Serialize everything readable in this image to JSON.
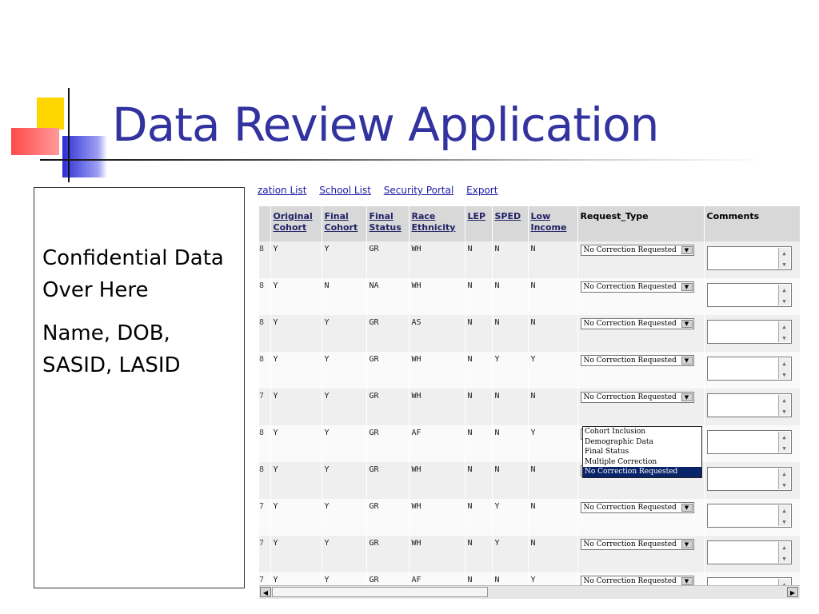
{
  "slide": {
    "title": "Data Review Application"
  },
  "left_box": {
    "line1": "Confidential Data Over Here",
    "line2": "Name, DOB, SASID, LASID"
  },
  "nav": [
    {
      "label": "zation List"
    },
    {
      "label": "School List"
    },
    {
      "label": "Security Portal"
    },
    {
      "label": "Export"
    }
  ],
  "columns": {
    "original_cohort": "Original Cohort",
    "final_cohort": "Final Cohort",
    "final_status": "Final Status",
    "race_ethnicity": "Race Ethnicity",
    "lep": "LEP",
    "sped": "SPED",
    "low_income": "Low Income",
    "request_type": "Request_Type",
    "comments": "Comments"
  },
  "rows": [
    {
      "idx": "8",
      "oc": "Y",
      "fc": "Y",
      "fs": "GR",
      "re": "WH",
      "lep": "N",
      "sped": "N",
      "li": "N",
      "req": "No Correction Requested"
    },
    {
      "idx": "8",
      "oc": "Y",
      "fc": "N",
      "fs": "NA",
      "re": "WH",
      "lep": "N",
      "sped": "N",
      "li": "N",
      "req": "No Correction Requested"
    },
    {
      "idx": "8",
      "oc": "Y",
      "fc": "Y",
      "fs": "GR",
      "re": "AS",
      "lep": "N",
      "sped": "N",
      "li": "N",
      "req": "No Correction Requested"
    },
    {
      "idx": "8",
      "oc": "Y",
      "fc": "Y",
      "fs": "GR",
      "re": "WH",
      "lep": "N",
      "sped": "Y",
      "li": "Y",
      "req": "No Correction Requested"
    },
    {
      "idx": "7",
      "oc": "Y",
      "fc": "Y",
      "fs": "GR",
      "re": "WH",
      "lep": "N",
      "sped": "N",
      "li": "N",
      "req": "No Correction Requested"
    },
    {
      "idx": "8",
      "oc": "Y",
      "fc": "Y",
      "fs": "GR",
      "re": "AF",
      "lep": "N",
      "sped": "N",
      "li": "Y",
      "req": "No Correction Requested"
    },
    {
      "idx": "8",
      "oc": "Y",
      "fc": "Y",
      "fs": "GR",
      "re": "WH",
      "lep": "N",
      "sped": "N",
      "li": "N",
      "req": "No Correction Requested"
    },
    {
      "idx": "7",
      "oc": "Y",
      "fc": "Y",
      "fs": "GR",
      "re": "WH",
      "lep": "N",
      "sped": "Y",
      "li": "N",
      "req": "No Correction Requested"
    },
    {
      "idx": "7",
      "oc": "Y",
      "fc": "Y",
      "fs": "GR",
      "re": "WH",
      "lep": "N",
      "sped": "Y",
      "li": "N",
      "req": "No Correction Requested"
    },
    {
      "idx": "7",
      "oc": "Y",
      "fc": "Y",
      "fs": "GR",
      "re": "AF",
      "lep": "N",
      "sped": "N",
      "li": "Y",
      "req": "No Correction Requested"
    }
  ],
  "dropdown_options": [
    {
      "label": "Cohort Inclusion",
      "selected": false
    },
    {
      "label": "Demographic Data",
      "selected": false
    },
    {
      "label": "Final Status",
      "selected": false
    },
    {
      "label": "Multiple Correction",
      "selected": false
    },
    {
      "label": "No Correction Requested",
      "selected": true
    }
  ],
  "icons": {
    "dropdown_arrow": "chevron-down-icon",
    "scroll_left": "arrow-left-icon",
    "scroll_right": "arrow-right-icon"
  },
  "colors": {
    "title": "#3333a0",
    "link": "#1a1aa6",
    "header_bg": "#d8d8d8",
    "selected_option_bg": "#0a246a"
  }
}
